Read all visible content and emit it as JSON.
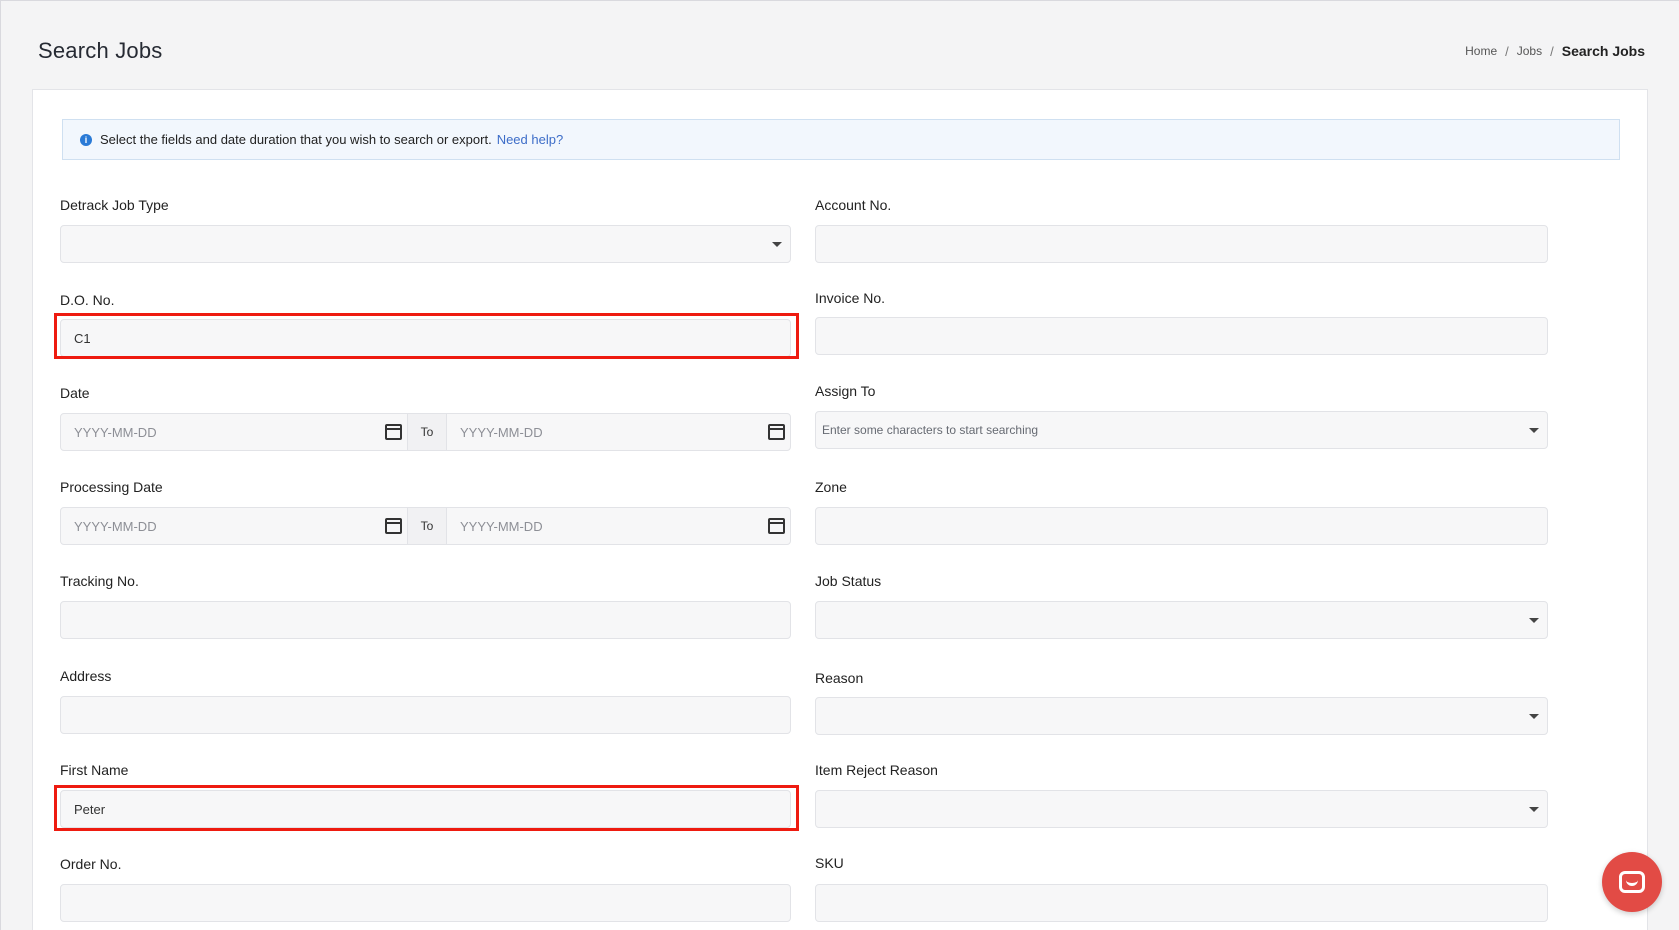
{
  "header": {
    "title": "Search Jobs",
    "breadcrumb": [
      "Home",
      "Jobs",
      "Search Jobs"
    ]
  },
  "info": {
    "message": "Select the fields and date duration that you wish to search or export.",
    "link": "Need help?"
  },
  "form": {
    "detrack_job_type": {
      "label": "Detrack Job Type",
      "value": ""
    },
    "account_no": {
      "label": "Account No.",
      "value": ""
    },
    "do_no": {
      "label": "D.O. No.",
      "value": "C1"
    },
    "invoice_no": {
      "label": "Invoice No.",
      "value": ""
    },
    "date": {
      "label": "Date",
      "from_placeholder": "YYYY-MM-DD",
      "to_label": "To",
      "to_placeholder": "YYYY-MM-DD"
    },
    "assign_to": {
      "label": "Assign To",
      "placeholder": "Enter some characters to start searching"
    },
    "processing_date": {
      "label": "Processing Date",
      "from_placeholder": "YYYY-MM-DD",
      "to_label": "To",
      "to_placeholder": "YYYY-MM-DD"
    },
    "zone": {
      "label": "Zone",
      "value": ""
    },
    "tracking_no": {
      "label": "Tracking No.",
      "value": ""
    },
    "job_status": {
      "label": "Job Status",
      "value": ""
    },
    "address": {
      "label": "Address",
      "value": ""
    },
    "reason": {
      "label": "Reason",
      "value": ""
    },
    "first_name": {
      "label": "First Name",
      "value": "Peter"
    },
    "item_reject_reason": {
      "label": "Item Reject Reason",
      "value": ""
    },
    "order_no": {
      "label": "Order No.",
      "value": ""
    },
    "sku": {
      "label": "SKU",
      "value": ""
    }
  },
  "colors": {
    "highlight": "#ee1b10",
    "link": "#3d6dc8",
    "chat": "#e24b45"
  },
  "icons": {
    "info": "info-icon",
    "calendar": "calendar-icon",
    "caret": "chevron-down-icon",
    "chat": "chat-icon"
  }
}
